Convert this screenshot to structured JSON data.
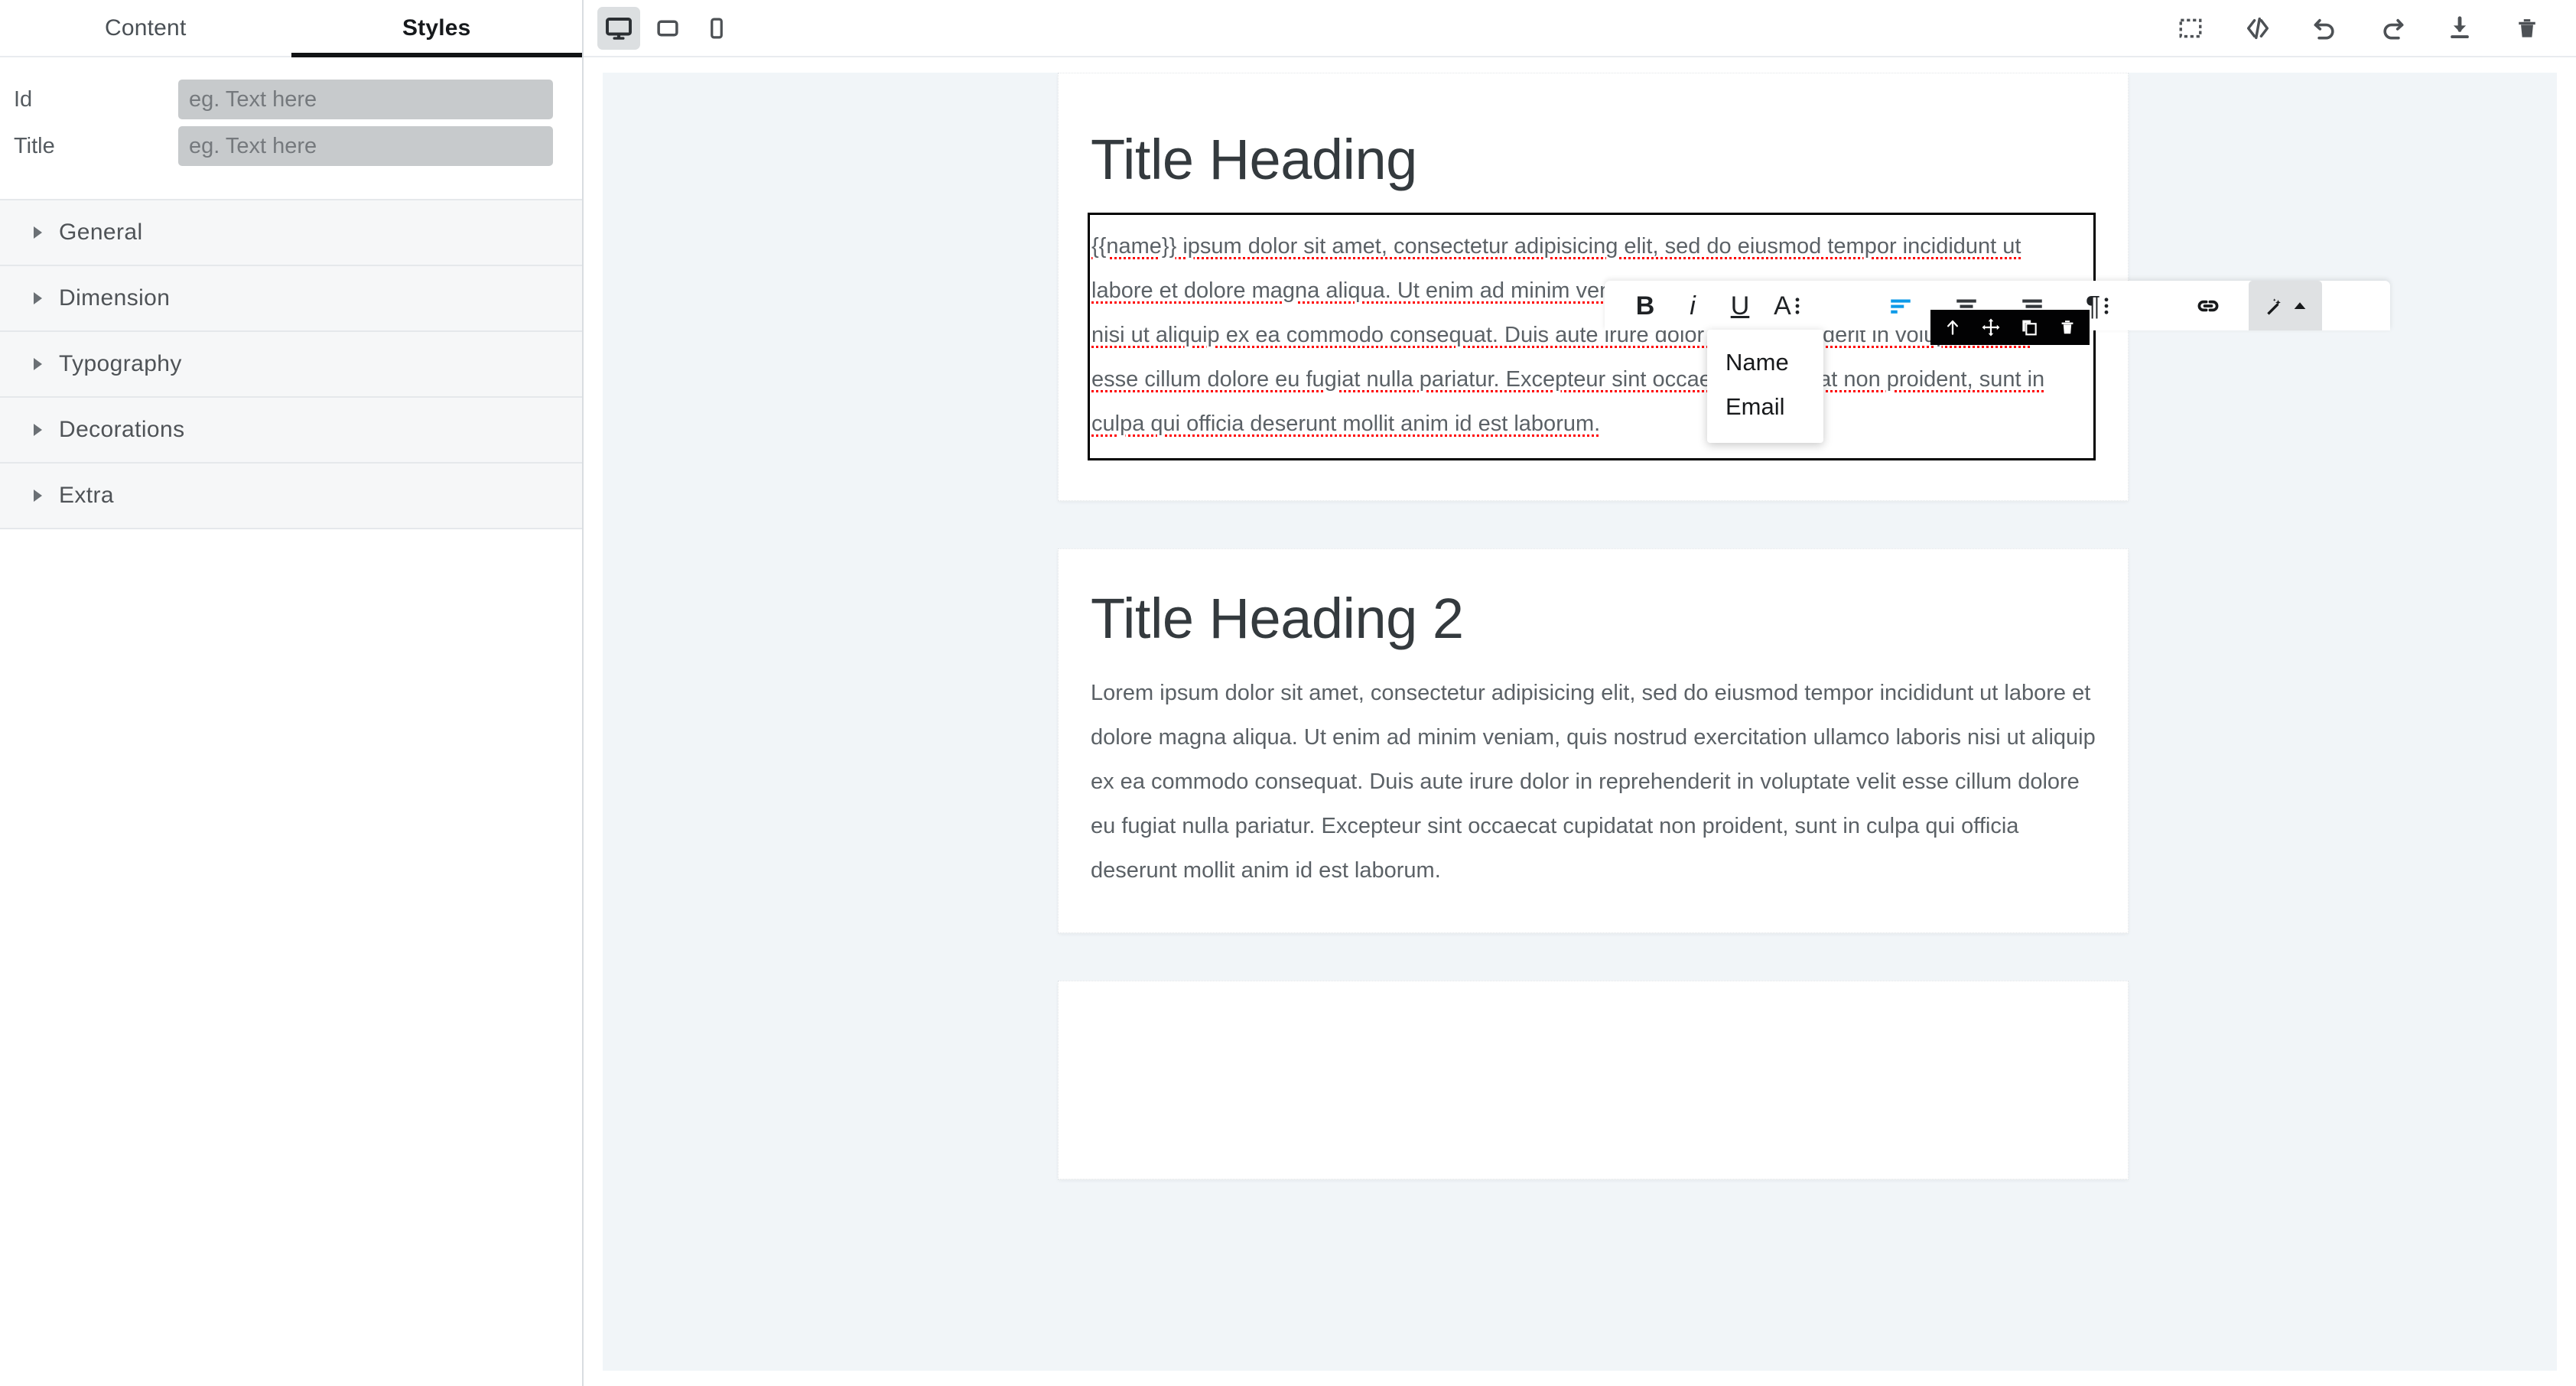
{
  "left_panel": {
    "tabs": [
      {
        "label": "Content",
        "active": false
      },
      {
        "label": "Styles",
        "active": true
      }
    ],
    "fields": [
      {
        "label": "Id",
        "value": "",
        "placeholder": "eg. Text here"
      },
      {
        "label": "Title",
        "value": "",
        "placeholder": "eg. Text here"
      }
    ],
    "accordion": [
      {
        "label": "General"
      },
      {
        "label": "Dimension"
      },
      {
        "label": "Typography"
      },
      {
        "label": "Decorations"
      },
      {
        "label": "Extra"
      }
    ]
  },
  "topbar": {
    "devices": [
      {
        "name": "desktop",
        "label": "Desktop",
        "active": true
      },
      {
        "name": "tablet",
        "label": "Tablet",
        "active": false
      },
      {
        "name": "mobile",
        "label": "Mobile",
        "active": false
      }
    ],
    "tools": [
      {
        "name": "borders-icon",
        "label": "View components"
      },
      {
        "name": "code-icon",
        "label": "View code"
      },
      {
        "name": "undo-icon",
        "label": "Undo"
      },
      {
        "name": "redo-icon",
        "label": "Redo"
      },
      {
        "name": "import-icon",
        "label": "Import"
      },
      {
        "name": "trash-icon",
        "label": "Clear canvas"
      }
    ]
  },
  "rte_toolbar": {
    "buttons": [
      {
        "name": "bold-button",
        "glyph": "B",
        "active": false
      },
      {
        "name": "italic-button",
        "glyph": "i",
        "active": false
      },
      {
        "name": "underline-button",
        "glyph": "U",
        "active": false
      },
      {
        "name": "font-color-button",
        "glyph": "A",
        "active": false
      },
      {
        "name": "align-left-button",
        "glyph": "align-left",
        "active": true
      },
      {
        "name": "align-center-button",
        "glyph": "align-center",
        "active": false
      },
      {
        "name": "align-right-button",
        "glyph": "align-right",
        "active": false
      },
      {
        "name": "paragraph-style-button",
        "glyph": "¶",
        "active": false
      },
      {
        "name": "link-button",
        "glyph": "link",
        "active": false
      },
      {
        "name": "merge-tag-button",
        "glyph": "magic-wand",
        "active": true
      }
    ],
    "active_color": "#0d9ae8"
  },
  "merge_dropdown": {
    "items": [
      {
        "label": "Name"
      },
      {
        "label": "Email"
      }
    ]
  },
  "component_toolbar": {
    "buttons": [
      {
        "name": "select-parent-icon",
        "label": "Select parent"
      },
      {
        "name": "move-icon",
        "label": "Move"
      },
      {
        "name": "duplicate-icon",
        "label": "Duplicate"
      },
      {
        "name": "delete-icon",
        "label": "Delete"
      }
    ]
  },
  "canvas": {
    "background": "#f1f5f8",
    "cards": [
      {
        "heading": "Title Heading",
        "selected": true,
        "body": "{{name}} ipsum dolor sit amet, consectetur adipisicing elit, sed do eiusmod tempor incididunt ut labore et dolore magna aliqua. Ut enim ad minim veniam, quis nostrud exercitation ullamco laboris nisi ut aliquip ex ea commodo consequat. Duis aute irure dolor in reprehenderit in voluptate velit esse cillum dolore eu fugiat nulla pariatur. Excepteur sint occaecat cupidatat non proident, sunt in culpa qui officia deserunt mollit anim id est laborum."
      },
      {
        "heading": "Title Heading 2",
        "selected": false,
        "body": "Lorem ipsum dolor sit amet, consectetur adipisicing elit, sed do eiusmod tempor incididunt ut labore et dolore magna aliqua. Ut enim ad minim veniam, quis nostrud exercitation ullamco laboris nisi ut aliquip ex ea commodo consequat. Duis aute irure dolor in reprehenderit in voluptate velit esse cillum dolore eu fugiat nulla pariatur. Excepteur sint occaecat cupidatat non proident, sunt in culpa qui officia deserunt mollit anim id est laborum."
      },
      {
        "heading": "",
        "selected": false,
        "body": ""
      }
    ]
  }
}
